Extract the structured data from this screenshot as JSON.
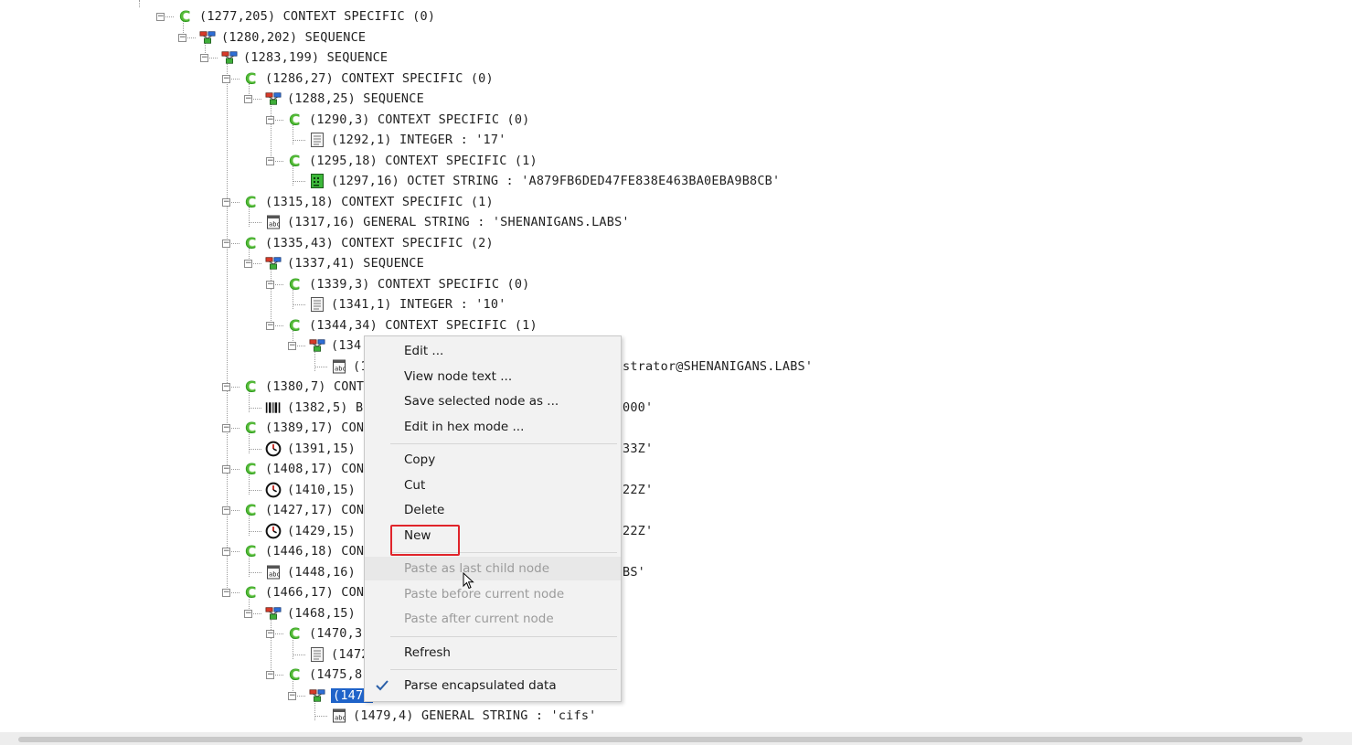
{
  "tree": {
    "nodes": [
      {
        "depth": 0,
        "row": 0,
        "icon": "context-icon",
        "text": "(1277,205) CONTEXT SPECIFIC (0)",
        "expander": true
      },
      {
        "depth": 1,
        "row": 1,
        "icon": "sequence-icon",
        "text": "(1280,202) SEQUENCE",
        "expander": true
      },
      {
        "depth": 2,
        "row": 2,
        "icon": "sequence-icon",
        "text": "(1283,199) SEQUENCE",
        "expander": true
      },
      {
        "depth": 3,
        "row": 3,
        "icon": "context-icon",
        "text": "(1286,27) CONTEXT SPECIFIC (0)",
        "expander": true
      },
      {
        "depth": 4,
        "row": 4,
        "icon": "sequence-icon",
        "text": "(1288,25) SEQUENCE",
        "expander": true
      },
      {
        "depth": 5,
        "row": 5,
        "icon": "context-icon",
        "text": "(1290,3) CONTEXT SPECIFIC (0)",
        "expander": true
      },
      {
        "depth": 6,
        "row": 6,
        "icon": "integer-icon",
        "text": "(1292,1) INTEGER : '17'",
        "expander": false
      },
      {
        "depth": 5,
        "row": 7,
        "icon": "context-icon",
        "text": "(1295,18) CONTEXT SPECIFIC (1)",
        "expander": true
      },
      {
        "depth": 6,
        "row": 8,
        "icon": "octet-string-icon",
        "text": "(1297,16) OCTET STRING : 'A879FB6DED47FE838E463BA0EBA9B8CB'",
        "expander": false
      },
      {
        "depth": 3,
        "row": 9,
        "icon": "context-icon",
        "text": "(1315,18) CONTEXT SPECIFIC (1)",
        "expander": true
      },
      {
        "depth": 4,
        "row": 10,
        "icon": "string-icon",
        "text": "(1317,16) GENERAL STRING : 'SHENANIGANS.LABS'",
        "expander": false
      },
      {
        "depth": 3,
        "row": 11,
        "icon": "context-icon",
        "text": "(1335,43) CONTEXT SPECIFIC (2)",
        "expander": true
      },
      {
        "depth": 4,
        "row": 12,
        "icon": "sequence-icon",
        "text": "(1337,41) SEQUENCE",
        "expander": true
      },
      {
        "depth": 5,
        "row": 13,
        "icon": "context-icon",
        "text": "(1339,3) CONTEXT SPECIFIC (0)",
        "expander": true
      },
      {
        "depth": 6,
        "row": 14,
        "icon": "integer-icon",
        "text": "(1341,1) INTEGER : '10'",
        "expander": false
      },
      {
        "depth": 5,
        "row": 15,
        "icon": "context-icon",
        "text": "(1344,34) CONTEXT SPECIFIC (1)",
        "expander": true
      },
      {
        "depth": 6,
        "row": 16,
        "icon": "sequence-icon",
        "text": "(134(",
        "expander": true
      },
      {
        "depth": 7,
        "row": 17,
        "icon": "string-icon",
        "text": "(1",
        "expander": false,
        "tail": "strator@SHENANIGANS.LABS'"
      },
      {
        "depth": 3,
        "row": 18,
        "icon": "context-icon",
        "text": "(1380,7) CONT",
        "expander": true
      },
      {
        "depth": 4,
        "row": 19,
        "icon": "bit-string-icon",
        "text": "(1382,5) B",
        "expander": false,
        "tail": "000'"
      },
      {
        "depth": 3,
        "row": 20,
        "icon": "context-icon",
        "text": "(1389,17) CON",
        "expander": true
      },
      {
        "depth": 4,
        "row": 21,
        "icon": "time-icon",
        "text": "(1391,15)",
        "expander": false,
        "tail": "33Z'"
      },
      {
        "depth": 3,
        "row": 22,
        "icon": "context-icon",
        "text": "(1408,17) CON",
        "expander": true
      },
      {
        "depth": 4,
        "row": 23,
        "icon": "time-icon",
        "text": "(1410,15)",
        "expander": false,
        "tail": "22Z'"
      },
      {
        "depth": 3,
        "row": 24,
        "icon": "context-icon",
        "text": "(1427,17) CON",
        "expander": true
      },
      {
        "depth": 4,
        "row": 25,
        "icon": "time-icon",
        "text": "(1429,15)",
        "expander": false,
        "tail": "22Z'"
      },
      {
        "depth": 3,
        "row": 26,
        "icon": "context-icon",
        "text": "(1446,18) CON",
        "expander": true
      },
      {
        "depth": 4,
        "row": 27,
        "icon": "string-icon",
        "text": "(1448,16)",
        "expander": false,
        "tail": "BS'"
      },
      {
        "depth": 3,
        "row": 28,
        "icon": "context-icon",
        "text": "(1466,17) CON",
        "expander": true
      },
      {
        "depth": 4,
        "row": 29,
        "icon": "sequence-icon",
        "text": "(1468,15)",
        "expander": true
      },
      {
        "depth": 5,
        "row": 30,
        "icon": "context-icon",
        "text": "(1470,3",
        "expander": true
      },
      {
        "depth": 6,
        "row": 31,
        "icon": "integer-icon",
        "text": "(1472",
        "expander": false
      },
      {
        "depth": 5,
        "row": 32,
        "icon": "context-icon",
        "text": "(1475,8",
        "expander": true
      },
      {
        "depth": 6,
        "row": 33,
        "icon": "sequence-icon",
        "text": "(1477",
        "expander": true,
        "selected": true
      },
      {
        "depth": 7,
        "row": 34,
        "icon": "string-icon",
        "text": "(1479,4) GENERAL STRING : 'cifs'",
        "expander": false
      }
    ]
  },
  "context_menu": {
    "items": [
      {
        "label": "Edit ...",
        "name": "menu-edit",
        "disabled": false
      },
      {
        "label": "View node text ...",
        "name": "menu-view-node-text",
        "disabled": false
      },
      {
        "label": "Save selected node as ...",
        "name": "menu-save-selected-node",
        "disabled": false
      },
      {
        "label": "Edit in hex mode ...",
        "name": "menu-edit-hex-mode",
        "disabled": false
      },
      {
        "sep": true
      },
      {
        "label": "Copy",
        "name": "menu-copy",
        "disabled": false
      },
      {
        "label": "Cut",
        "name": "menu-cut",
        "disabled": false
      },
      {
        "label": "Delete",
        "name": "menu-delete",
        "disabled": false
      },
      {
        "label": "New",
        "name": "menu-new",
        "disabled": false
      },
      {
        "sep": true
      },
      {
        "label": "Paste as last child node",
        "name": "menu-paste-last-child",
        "disabled": true,
        "hover": true
      },
      {
        "label": "Paste before current node",
        "name": "menu-paste-before",
        "disabled": true
      },
      {
        "label": "Paste after current node",
        "name": "menu-paste-after",
        "disabled": true
      },
      {
        "sep": true
      },
      {
        "label": "Refresh",
        "name": "menu-refresh",
        "disabled": false
      },
      {
        "sep": true
      },
      {
        "label": "Parse encapsulated data",
        "name": "menu-parse-encapsulated",
        "disabled": false,
        "checked": true
      }
    ]
  },
  "colors": {
    "accent": "#1f63c9",
    "highlight_box": "#e0242a",
    "context_icon": "#2e9c1e"
  }
}
